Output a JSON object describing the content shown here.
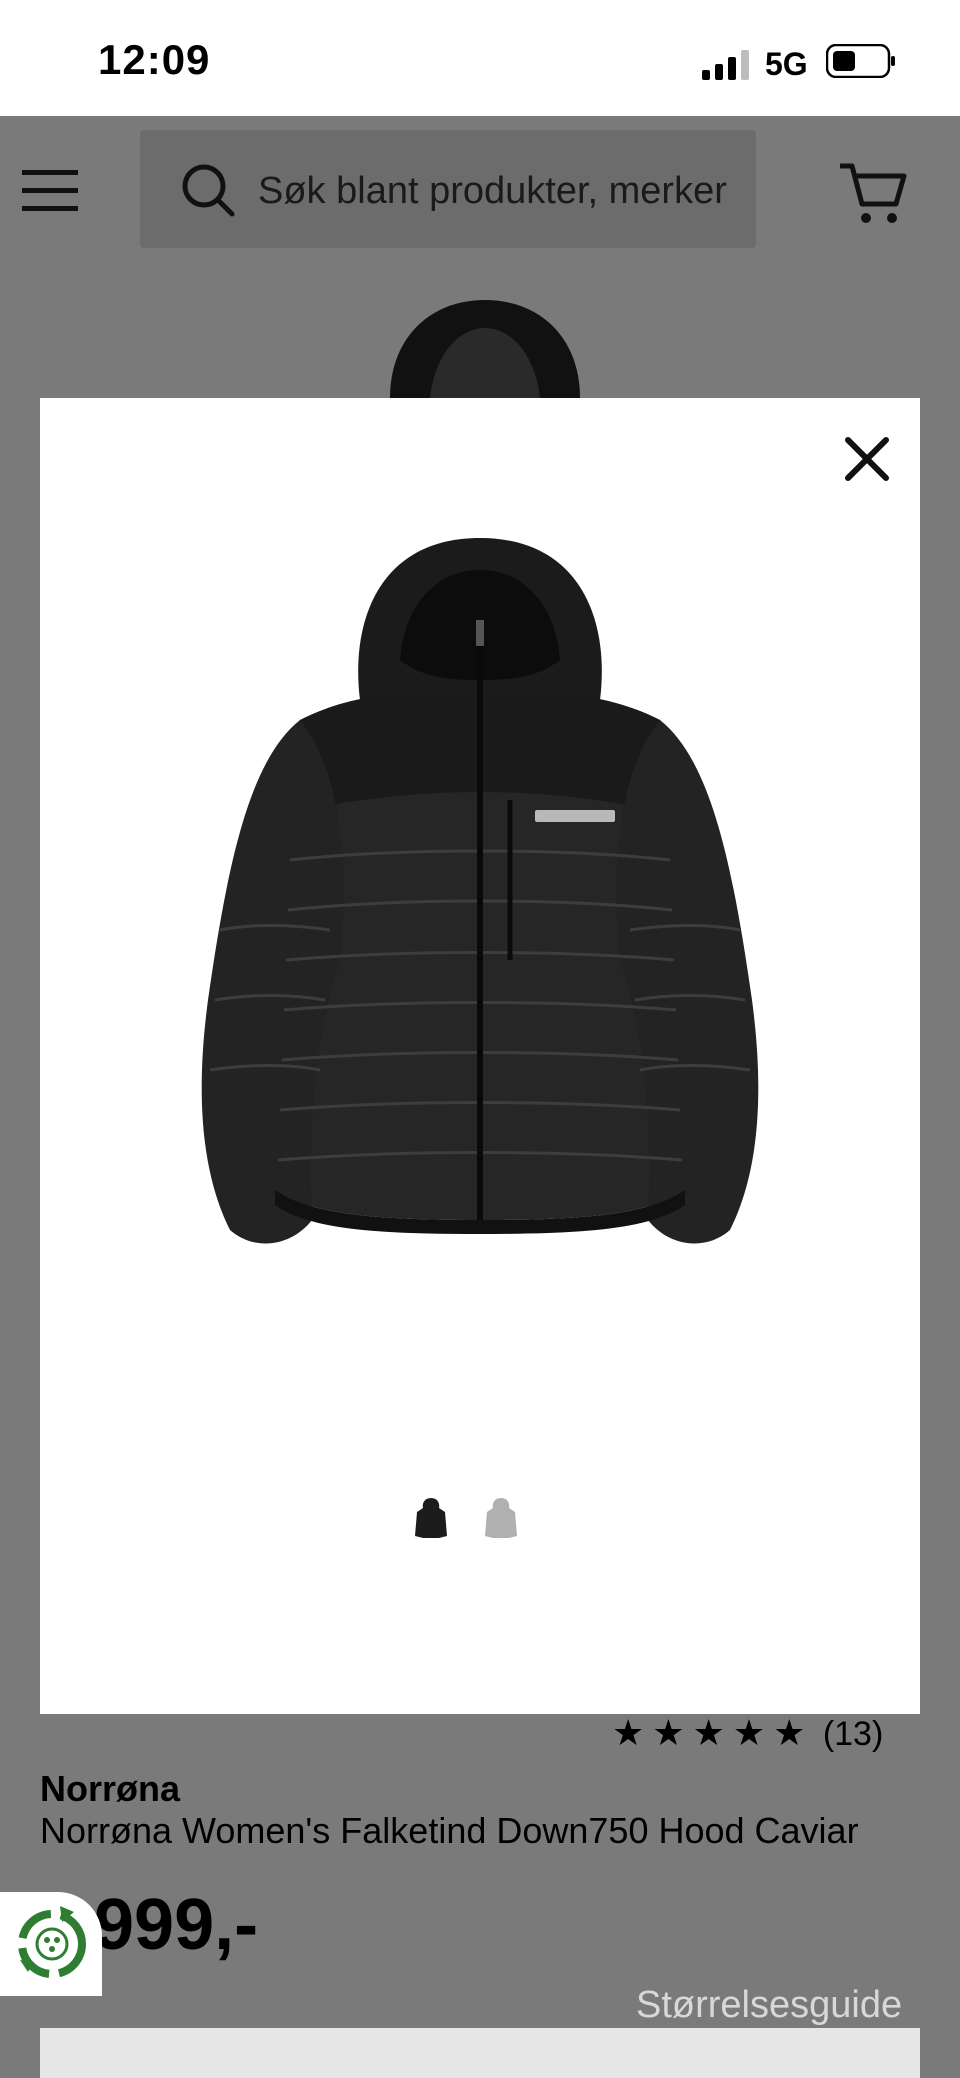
{
  "status_bar": {
    "time": "12:09",
    "network": "5G"
  },
  "header": {
    "search_placeholder": "Søk blant produkter, merker",
    "menu_icon": "hamburger-menu-icon",
    "search_icon": "search-icon",
    "cart_icon": "cart-icon"
  },
  "modal": {
    "close_icon": "close-icon",
    "thumbnails": [
      {
        "name": "jacket-black-thumbnail",
        "selected": true
      },
      {
        "name": "jacket-grey-thumbnail",
        "selected": false
      }
    ]
  },
  "product": {
    "stars": "★★★★★",
    "rating": 5,
    "rating_count": "(13)",
    "brand": "Norrøna",
    "name": "Norrøna Women's Falketind Down750 Hood Caviar",
    "price": "999,-",
    "size_guide": "Størrelsesguide"
  },
  "colors": {
    "overlay": "#7a7a7a",
    "modal_bg": "#ffffff",
    "eco_green": "#2e7d32"
  }
}
